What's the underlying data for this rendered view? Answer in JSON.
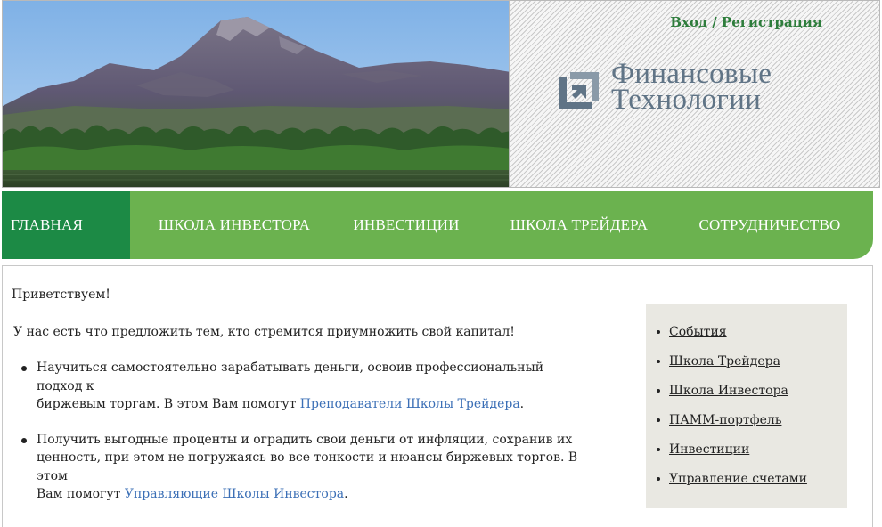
{
  "header": {
    "auth_link": "Вход / Регистрация",
    "logo_line1": "Финансовые",
    "logo_line2": "Технологии",
    "logo_icon": "square-arrow-logo-icon"
  },
  "nav": {
    "items": [
      {
        "label": "ГЛАВНАЯ",
        "active": true
      },
      {
        "label": "ШКОЛА ИНВЕСТОРА",
        "active": false
      },
      {
        "label": "ИНВЕСТИЦИИ",
        "active": false
      },
      {
        "label": "ШКОЛА ТРЕЙДЕРА",
        "active": false
      },
      {
        "label": "СОТРУДНИЧЕСТВО",
        "active": false
      }
    ]
  },
  "main": {
    "greeting": "Приветствуем!",
    "intro": "У нас есть что предложить тем, кто стремится приумножить свой капитал!",
    "bullets": [
      {
        "line1": "Научиться самостоятельно зарабатывать деньги, освоив профессиональный подход к",
        "line2_text": "биржевым торгам. В этом Вам помогут ",
        "link": "Преподаватели Школы Трейдера",
        "tail": "."
      },
      {
        "line1": "Получить выгодные проценты и оградить свои деньги от инфляции, сохранив их",
        "line2": "ценность, при этом не погружаясь во все тонкости и нюансы биржевых торгов. В этом",
        "line3_text": "Вам помогут ",
        "link": "Управляющие Школы Инвестора",
        "tail": "."
      }
    ]
  },
  "sidebar": {
    "items": [
      "События",
      "Школа Трейдера",
      "Школа Инвестора",
      "ПАММ-портфель",
      "Инвестиции",
      "Управление счетами"
    ]
  },
  "colors": {
    "nav_bg": "#6bb24f",
    "nav_active": "#1c8a45",
    "auth_link": "#2e7d3c",
    "logo_text": "#607486",
    "sidebar_bg": "#e9e8e2",
    "link": "#3b6fb6"
  }
}
